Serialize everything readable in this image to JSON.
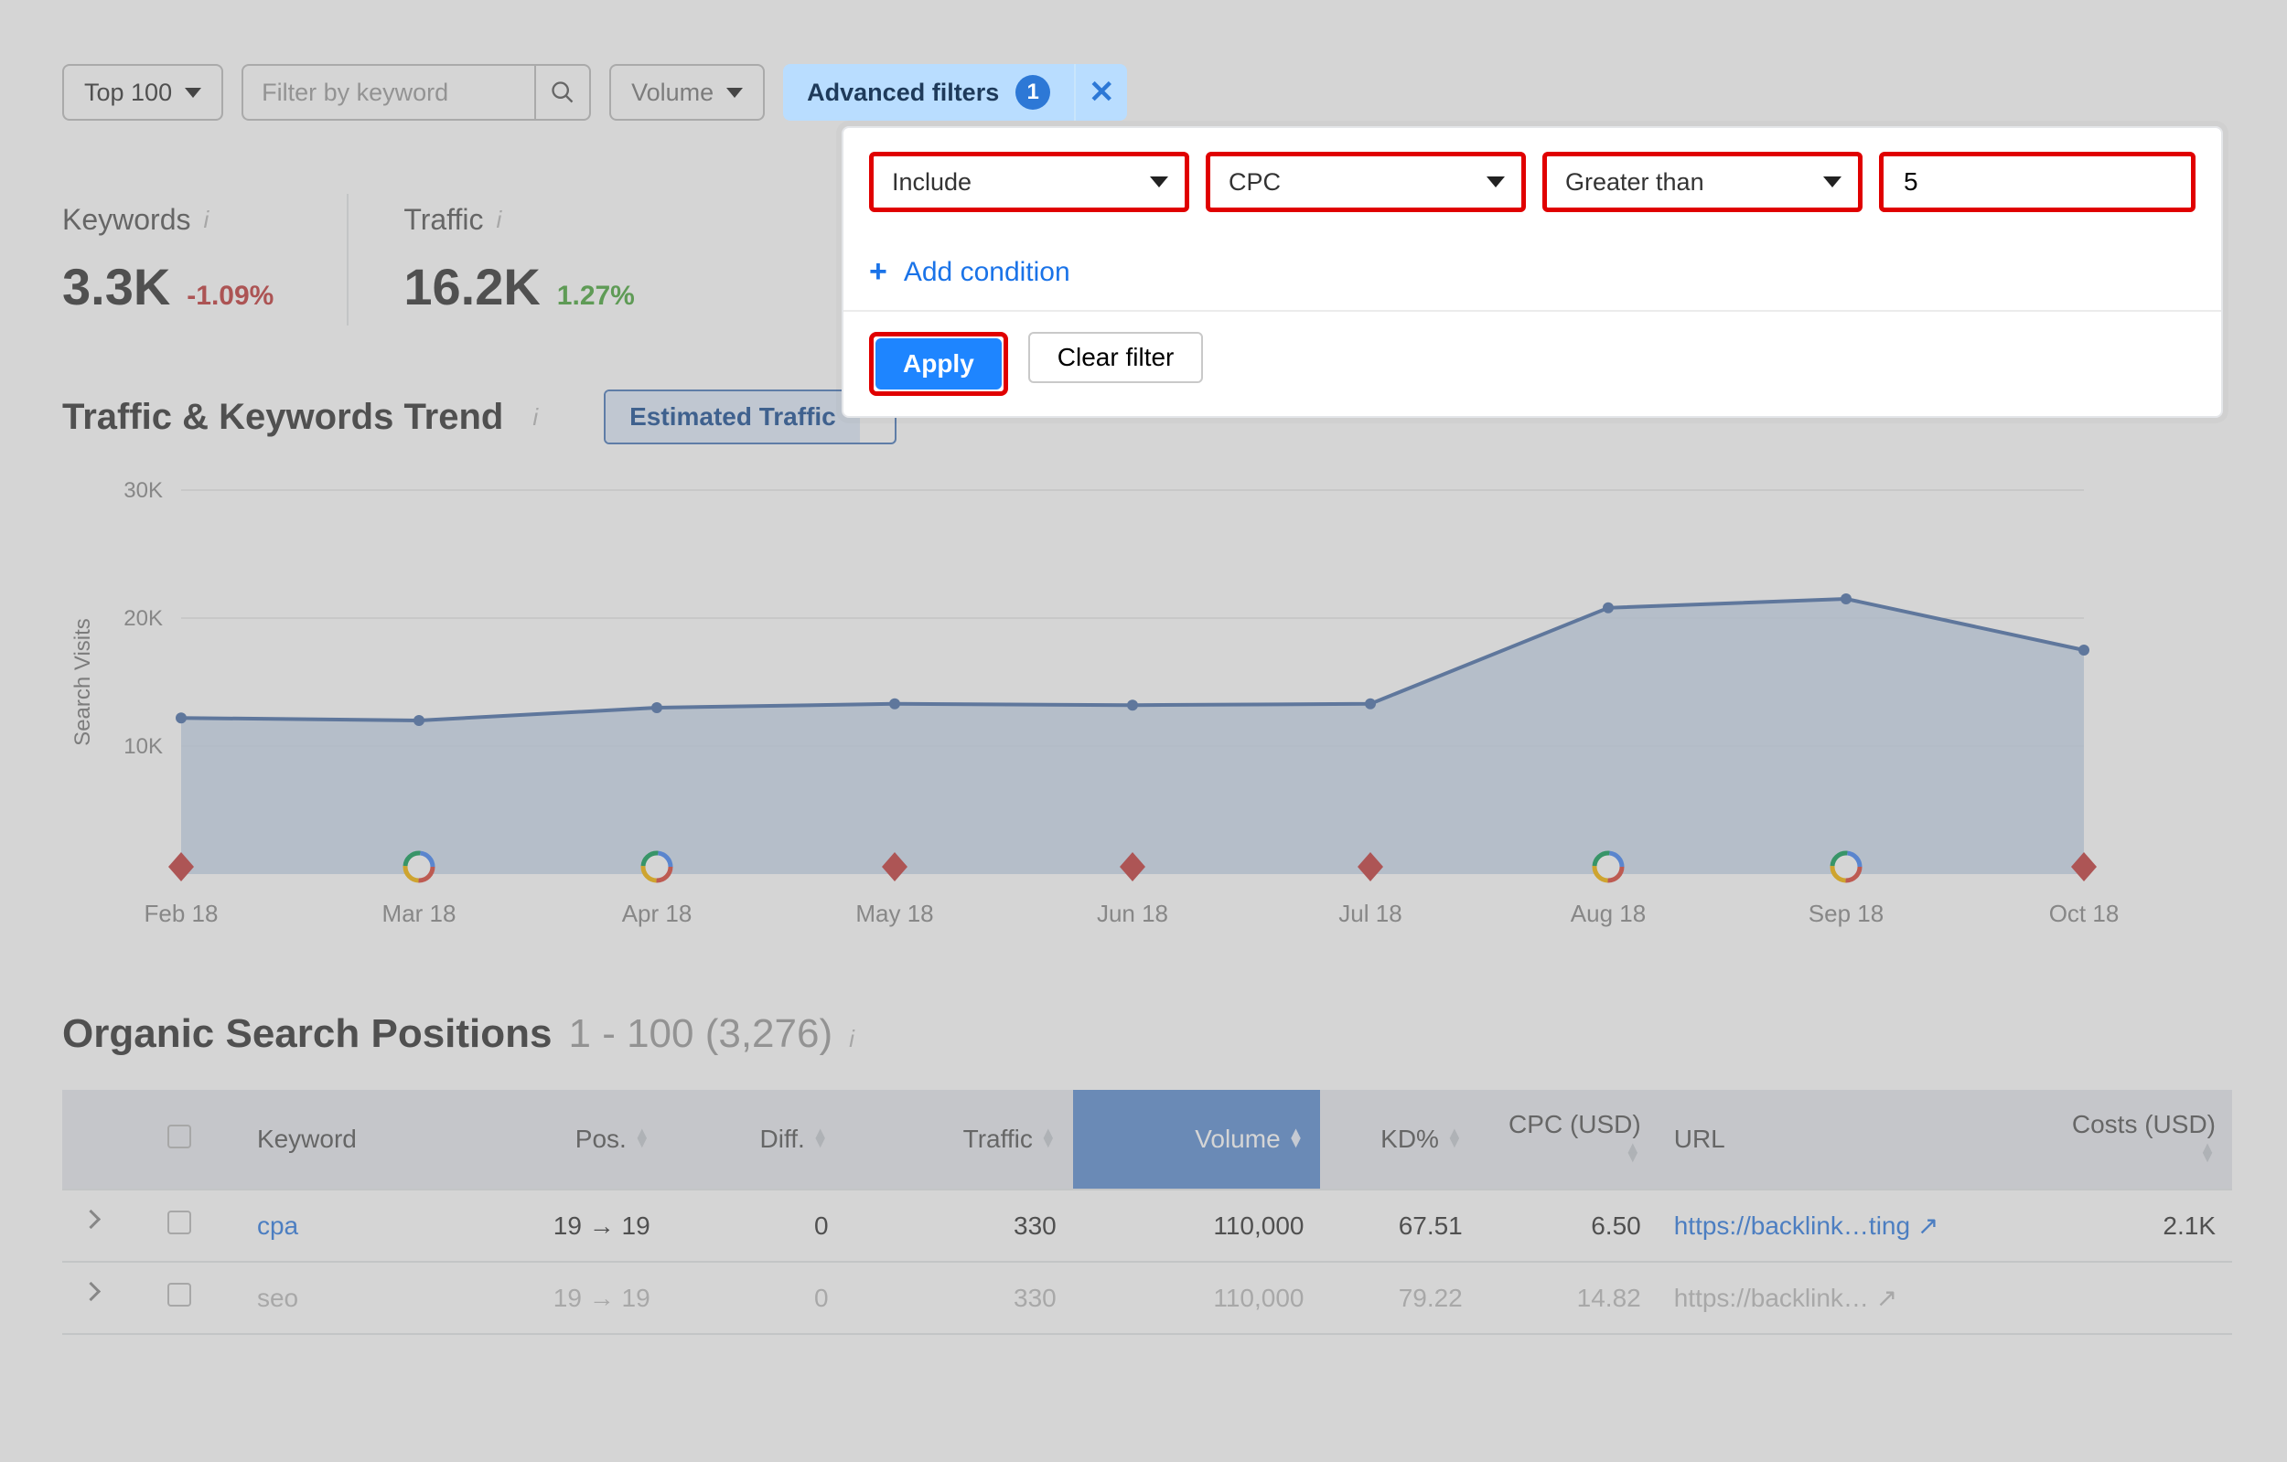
{
  "toolbar": {
    "top_label": "Top 100",
    "filter_placeholder": "Filter by keyword",
    "volume_label": "Volume",
    "advanced_label": "Advanced filters",
    "advanced_count": "1"
  },
  "filter_panel": {
    "mode": "Include",
    "metric": "CPC",
    "operator": "Greater than",
    "value": "5",
    "add_condition": "Add condition",
    "apply": "Apply",
    "clear": "Clear filter"
  },
  "kpis": {
    "keywords": {
      "label": "Keywords",
      "value": "3.3K",
      "delta": "-1.09%",
      "dir": "neg"
    },
    "traffic": {
      "label": "Traffic",
      "value": "16.2K",
      "delta": "1.27%",
      "dir": "pos"
    }
  },
  "trend": {
    "title": "Traffic & Keywords Trend",
    "toggle_a": "Estimated Traffic",
    "axis_label": "Search Visits"
  },
  "chart_data": {
    "type": "area",
    "xlabel": "",
    "ylabel": "Search Visits",
    "ylim": [
      0,
      30000
    ],
    "yticks": [
      10000,
      20000,
      30000
    ],
    "ytick_labels": [
      "10K",
      "20K",
      "30K"
    ],
    "categories": [
      "Feb 18",
      "Mar 18",
      "Apr 18",
      "May 18",
      "Jun 18",
      "Jul 18",
      "Aug 18",
      "Sep 18",
      "Oct 18"
    ],
    "values": [
      12200,
      12000,
      13000,
      13300,
      13200,
      13300,
      20800,
      21500,
      17500
    ],
    "markers": {
      "diamond": [
        "Feb 18",
        "May 18",
        "Jun 18",
        "Jul 18",
        "Oct 18"
      ],
      "google": [
        "Mar 18",
        "Apr 18",
        "Aug 18",
        "Sep 18"
      ]
    }
  },
  "table": {
    "title": "Organic Search Positions",
    "range": "1 - 100 (3,276)",
    "columns": {
      "keyword": "Keyword",
      "pos": "Pos.",
      "diff": "Diff.",
      "traffic": "Traffic",
      "volume": "Volume",
      "kd": "KD%",
      "cpc": "CPC (USD)",
      "url": "URL",
      "costs": "Costs (USD)"
    },
    "rows": [
      {
        "keyword": "cpa",
        "pos_from": "19",
        "pos_to": "19",
        "diff": "0",
        "traffic": "330",
        "volume": "110,000",
        "kd": "67.51",
        "cpc": "6.50",
        "url": "https://backlink…ting",
        "costs": "2.1K"
      },
      {
        "keyword": "seo",
        "pos_from": "19",
        "pos_to": "19",
        "diff": "0",
        "traffic": "330",
        "volume": "110,000",
        "kd": "79.22",
        "cpc": "14.82",
        "url": "https://backlink…",
        "costs": ""
      }
    ]
  }
}
